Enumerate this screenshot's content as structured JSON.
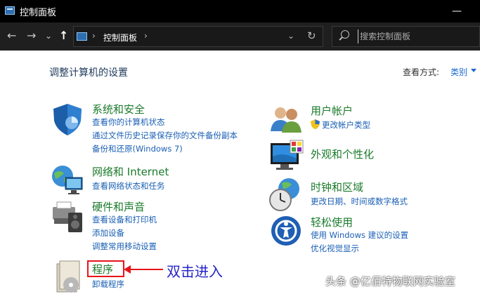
{
  "window": {
    "title": "控制面板",
    "minimize_glyph": "—"
  },
  "nav": {
    "back_glyph": "←",
    "forward_glyph": "→",
    "recent_glyph": "⌄",
    "up_glyph": "↑",
    "breadcrumb_sep": "›",
    "breadcrumb": "控制面板",
    "dropdown_glyph": "⌄",
    "refresh_glyph": "↻",
    "search_placeholder": "搜索控制面板"
  },
  "main": {
    "heading": "调整计算机的设置",
    "view_by_label": "查看方式:",
    "view_by_value": "类别"
  },
  "categories": [
    {
      "title": "系统和安全",
      "icon": "shield-icon",
      "links": [
        "查看你的计算机状态",
        "通过文件历史记录保存你的文件备份副本",
        "备份和还原(Windows 7)"
      ]
    },
    {
      "title": "网络和 Internet",
      "icon": "network-globe-icon",
      "links": [
        "查看网络状态和任务"
      ]
    },
    {
      "title": "硬件和声音",
      "icon": "printer-speaker-icon",
      "links": [
        "查看设备和打印机",
        "添加设备",
        "调整常用移动设置"
      ]
    },
    {
      "title": "程序",
      "icon": "programs-disc-icon",
      "links": [
        "卸载程序"
      ]
    },
    {
      "title": "用户帐户",
      "icon": "users-icon",
      "links": [
        "更改帐户类型"
      ]
    },
    {
      "title": "外观和个性化",
      "icon": "monitor-palette-icon",
      "links": []
    },
    {
      "title": "时钟和区域",
      "icon": "clock-globe-icon",
      "links": [
        "更改日期、时间或数字格式"
      ]
    },
    {
      "title": "轻松使用",
      "icon": "ease-of-access-icon",
      "links": [
        "使用 Windows 建议的设置",
        "优化视觉显示"
      ]
    }
  ],
  "annotation": {
    "text": "双击进入"
  },
  "watermark": {
    "text": "头条 @亿佰特物联网实验室"
  },
  "colors": {
    "title_green": "#1a7a2a",
    "link_blue": "#1a5fb4",
    "annotation_red": "#e8141a",
    "annotation_blue": "#2727c9"
  }
}
